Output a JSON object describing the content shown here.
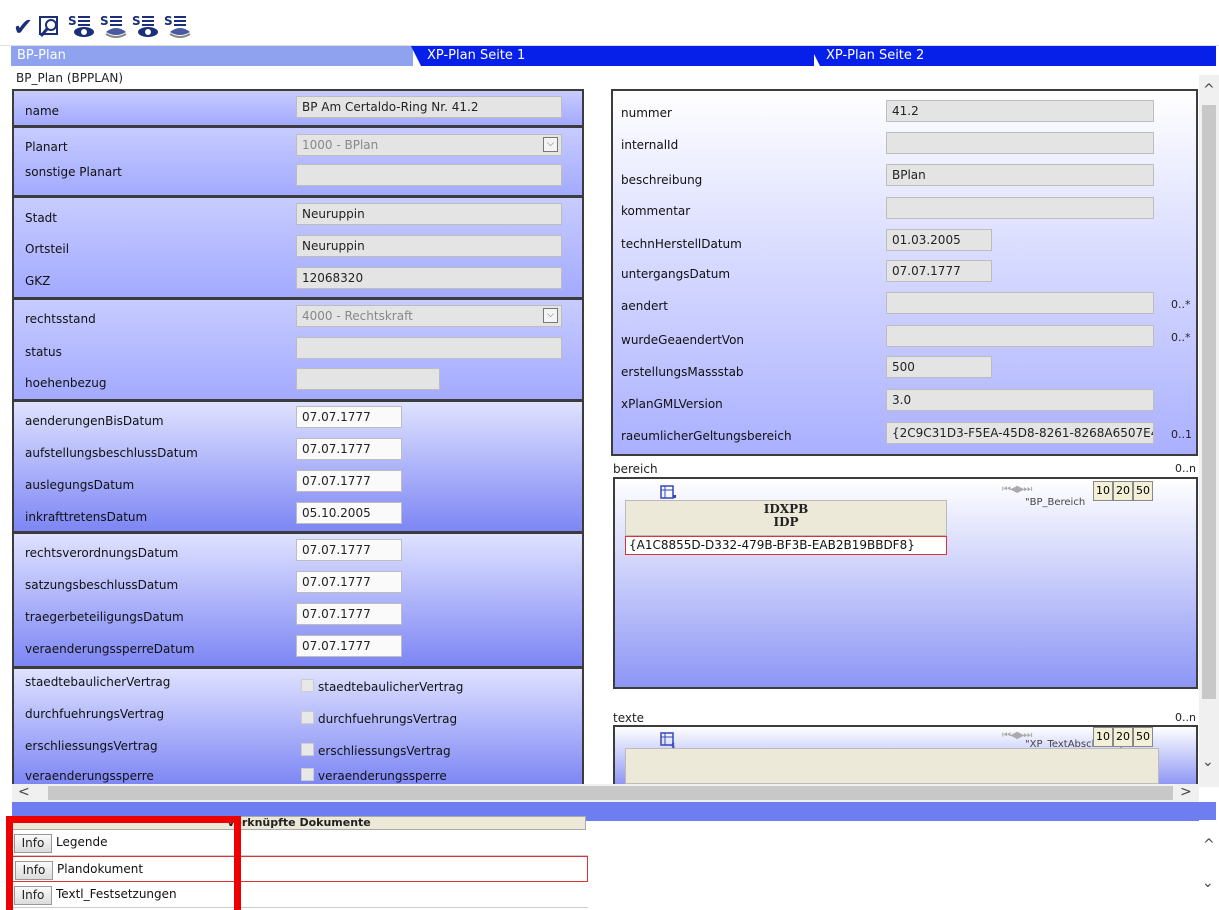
{
  "toolbar": {
    "buttons": [
      "check-icon",
      "search-icon",
      "sql-view-icon",
      "sql-view-icon",
      "sql-view-icon",
      "sql-view-icon"
    ]
  },
  "tabs": [
    {
      "label": "BP-Plan",
      "active": true
    },
    {
      "label": "XP-Plan Seite 1",
      "active": false
    },
    {
      "label": "XP-Plan Seite 2",
      "active": false
    }
  ],
  "form_title": "BP_Plan (BPPLAN)",
  "left": {
    "name": {
      "label": "name",
      "value": "BP Am Certaldo-Ring Nr. 41.2"
    },
    "planart": {
      "label": "Planart",
      "value": "1000 - BPlan"
    },
    "sonstige_planart": {
      "label": "sonstige Planart",
      "value": ""
    },
    "stadt": {
      "label": "Stadt",
      "value": "Neuruppin"
    },
    "ortsteil": {
      "label": "Ortsteil",
      "value": "Neuruppin"
    },
    "gkz": {
      "label": "GKZ",
      "value": "12068320"
    },
    "rechtsstand": {
      "label": "rechtsstand",
      "value": "4000 - Rechtskraft"
    },
    "status": {
      "label": "status",
      "value": ""
    },
    "hoehenbezug": {
      "label": "hoehenbezug",
      "value": ""
    },
    "aenderungen_bis_datum": {
      "label": "aenderungenBisDatum",
      "value": "07.07.1777"
    },
    "aufstellungsbeschluss_datum": {
      "label": "aufstellungsbeschlussDatum",
      "value": "07.07.1777"
    },
    "auslegungs_datum": {
      "label": "auslegungsDatum",
      "value": "07.07.1777"
    },
    "inkrafttretens_datum": {
      "label": "inkrafttretensDatum",
      "value": "05.10.2005"
    },
    "rechtsverordnungs_datum": {
      "label": "rechtsverordnungsDatum",
      "value": "07.07.1777"
    },
    "satzungsbeschluss_datum": {
      "label": "satzungsbeschlussDatum",
      "value": "07.07.1777"
    },
    "traegerbeteiligungs_datum": {
      "label": "traegerbeteiligungsDatum",
      "value": "07.07.1777"
    },
    "veraenderungssperre_datum": {
      "label": "veraenderungssperreDatum",
      "value": "07.07.1777"
    },
    "staedtebaulicher_vertrag": {
      "label": "staedtebaulicherVertrag",
      "check_label": "staedtebaulicherVertrag"
    },
    "durchfuehrungs_vertrag": {
      "label": "durchfuehrungsVertrag",
      "check_label": "durchfuehrungsVertrag"
    },
    "erschliessungs_vertrag": {
      "label": "erschliessungsVertrag",
      "check_label": "erschliessungsVertrag"
    },
    "veraenderungssperre": {
      "label": "veraenderungssperre",
      "check_label": "veraenderungssperre"
    }
  },
  "right": {
    "nummer": {
      "label": "nummer",
      "value": "41.2"
    },
    "internal_id": {
      "label": "internalId",
      "value": ""
    },
    "beschreibung": {
      "label": "beschreibung",
      "value": "BPlan"
    },
    "kommentar": {
      "label": "kommentar",
      "value": ""
    },
    "techn_herstell_datum": {
      "label": "technHerstellDatum",
      "value": "01.03.2005"
    },
    "untergangs_datum": {
      "label": "untergangsDatum",
      "value": "07.07.1777"
    },
    "aendert": {
      "label": "aendert",
      "value": "",
      "mult": "0..*"
    },
    "wurde_geaendert_von": {
      "label": "wurdeGeaendertVon",
      "value": "",
      "mult": "0..*"
    },
    "erstellungs_massstab": {
      "label": "erstellungsMassstab",
      "value": "500"
    },
    "xplan_gml_version": {
      "label": "xPlanGMLVersion",
      "value": "3.0"
    },
    "raeumlicher_geltungsbereich": {
      "label": "raeumlicherGeltungsbereich",
      "value": "{2C9C31D3-F5EA-45D8-8261-8268A6507E4",
      "mult": "0..1"
    }
  },
  "bereich": {
    "label": "bereich",
    "mult": "0..n",
    "caption": "\"BP_Bereich",
    "page_sizes": [
      "10",
      "20",
      "50"
    ],
    "header_1": "IDXPB",
    "header_2": "IDP",
    "rows": [
      "{A1C8855D-D332-479B-BF3B-EAB2B19BBDF8}"
    ]
  },
  "texte": {
    "label": "texte",
    "mult": "0..n",
    "caption": "\"XP_TextAbschnitt\")",
    "page_sizes": [
      "10",
      "20",
      "50"
    ]
  },
  "documents": {
    "header": "verknüpfte Dokumente",
    "info_label": "Info",
    "rows": [
      "Legende",
      "Plandokument",
      "Textl_Festsetzungen"
    ]
  },
  "colors": {
    "tab_active": "#8ea2ef",
    "tab_inactive": "#0620ea",
    "highlight": "#ee0000"
  }
}
